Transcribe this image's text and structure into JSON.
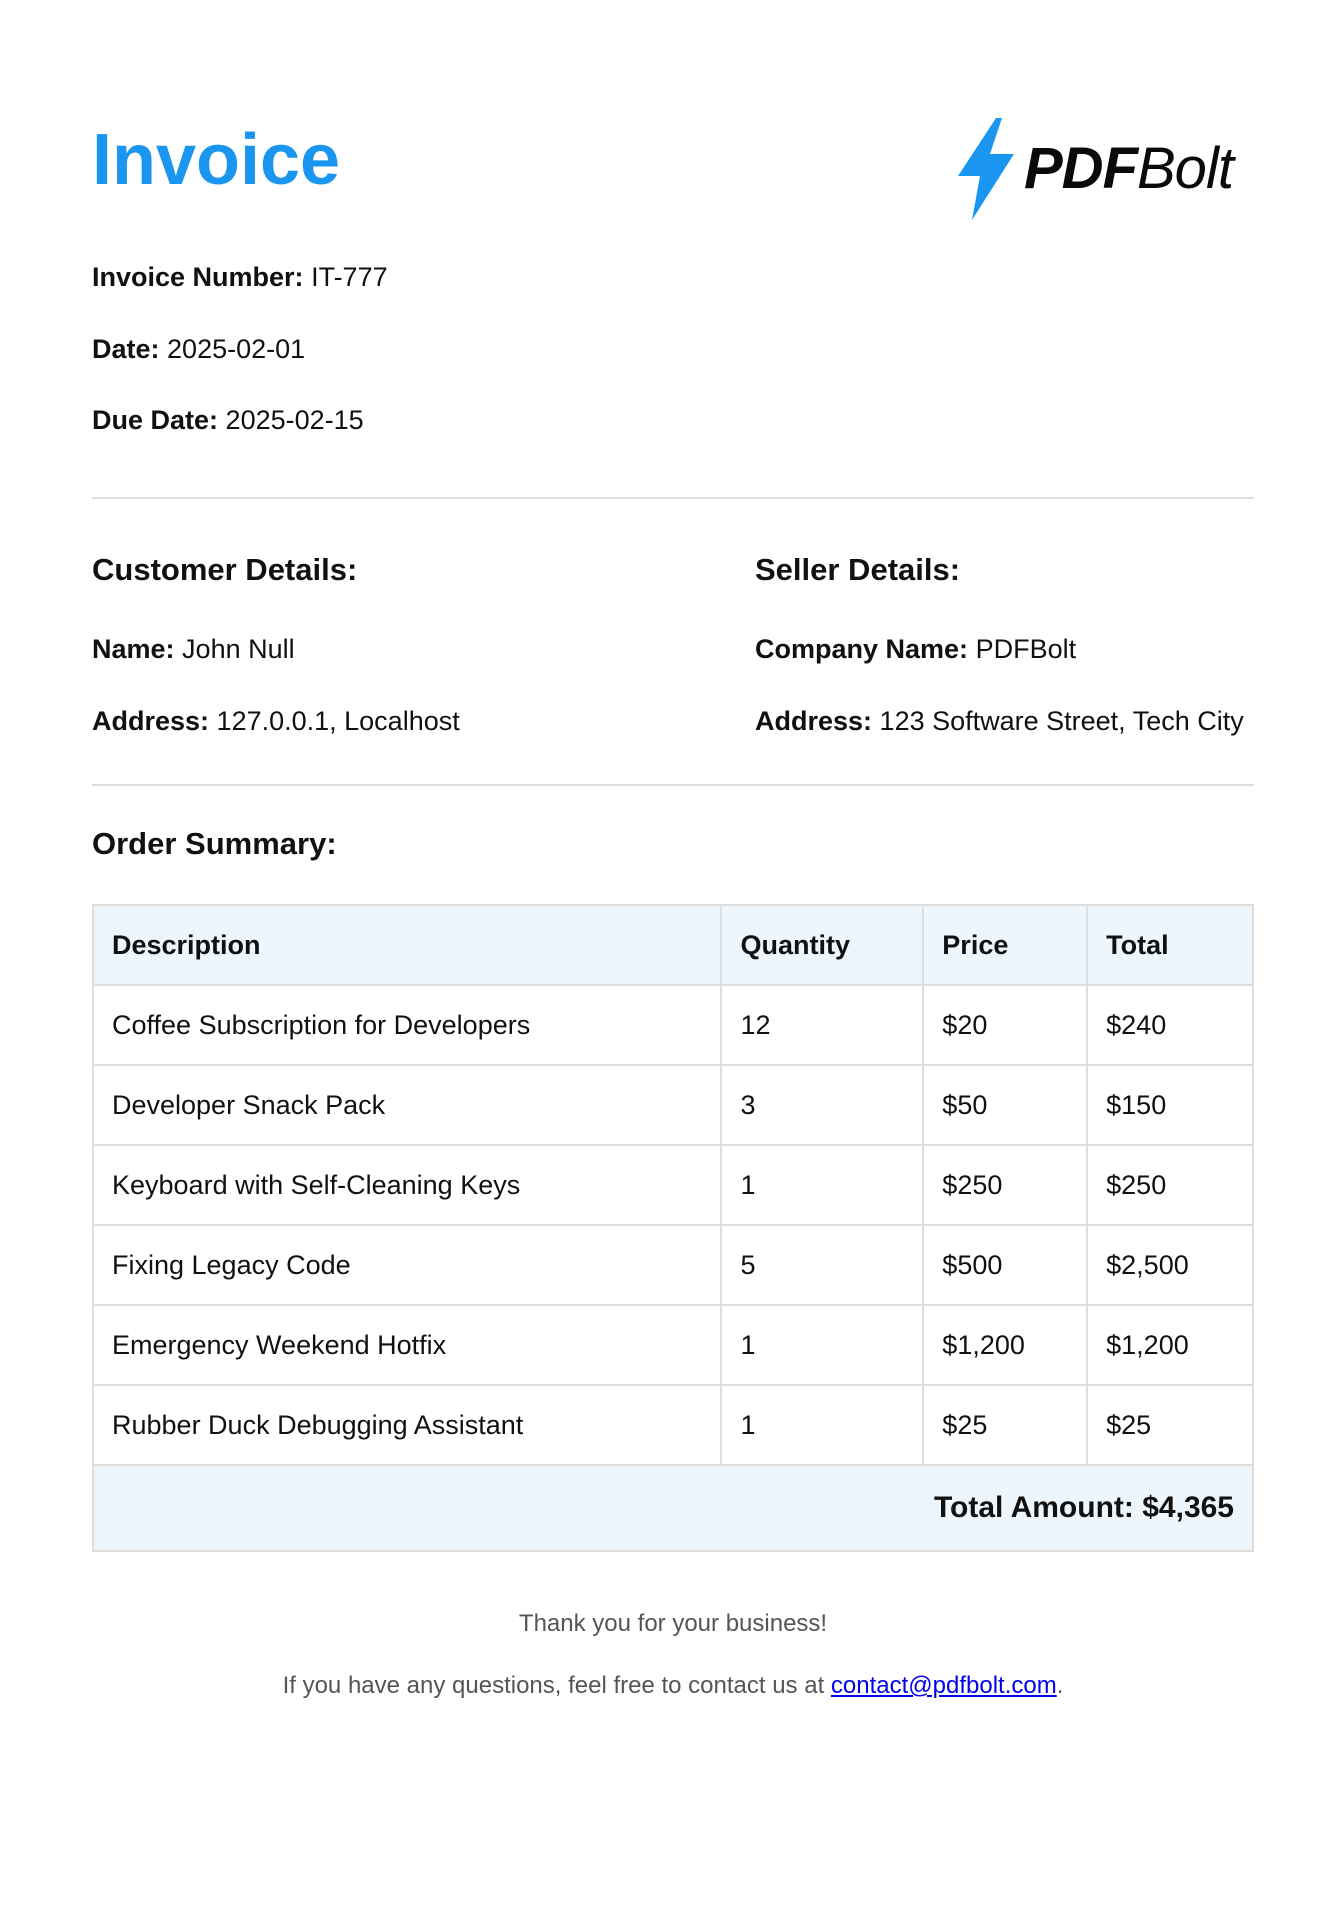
{
  "header": {
    "title": "Invoice",
    "logo_text_bold": "PDF",
    "logo_text_regular": "Bolt",
    "logo_color": "#1a96f0"
  },
  "invoice_info": {
    "number_label": "Invoice Number:",
    "number_value": "IT-777",
    "date_label": "Date:",
    "date_value": "2025-02-01",
    "due_label": "Due Date:",
    "due_value": "2025-02-15"
  },
  "customer": {
    "heading": "Customer Details:",
    "name_label": "Name:",
    "name_value": "John Null",
    "address_label": "Address:",
    "address_value": "127.0.0.1, Localhost"
  },
  "seller": {
    "heading": "Seller Details:",
    "company_label": "Company Name:",
    "company_value": "PDFBolt",
    "address_label": "Address:",
    "address_value": "123 Software Street, Tech City"
  },
  "order": {
    "heading": "Order Summary:",
    "columns": [
      "Description",
      "Quantity",
      "Price",
      "Total"
    ],
    "rows": [
      [
        "Coffee Subscription for Developers",
        "12",
        "$20",
        "$240"
      ],
      [
        "Developer Snack Pack",
        "3",
        "$50",
        "$150"
      ],
      [
        "Keyboard with Self-Cleaning Keys",
        "1",
        "$250",
        "$250"
      ],
      [
        "Fixing Legacy Code",
        "5",
        "$500",
        "$2,500"
      ],
      [
        "Emergency Weekend Hotfix",
        "1",
        "$1,200",
        "$1,200"
      ],
      [
        "Rubber Duck Debugging Assistant",
        "1",
        "$25",
        "$25"
      ]
    ],
    "total_label": "Total Amount:",
    "total_value": "$4,365"
  },
  "footer": {
    "thanks": "Thank you for your business!",
    "contact_prefix": "If you have any questions, feel free to contact us at",
    "contact_email": "contact@pdfbolt.com",
    "contact_suffix": "."
  }
}
